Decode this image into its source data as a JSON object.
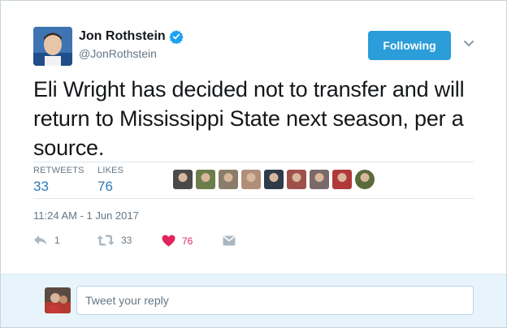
{
  "author": {
    "name": "Jon Rothstein",
    "handle": "@JonRothstein",
    "verified": true
  },
  "follow_button": {
    "label": "Following"
  },
  "tweet": {
    "text": "Eli Wright has decided not to transfer and will return to Mississippi State next season, per a source."
  },
  "stats": {
    "retweets_label": "RETWEETS",
    "retweets_value": "33",
    "likes_label": "LIKES",
    "likes_value": "76"
  },
  "liked_by_avatars": [
    {
      "color": "#4a4a4a"
    },
    {
      "color": "#6b7d4a"
    },
    {
      "color": "#8a7d6a"
    },
    {
      "color": "#b08f7a"
    },
    {
      "color": "#2f3a4a"
    },
    {
      "color": "#a0504a"
    },
    {
      "color": "#7a6a6a"
    },
    {
      "color": "#b03a3a"
    },
    {
      "color": "#5a6a3a"
    }
  ],
  "timestamp": "11:24 AM - 1 Jun 2017",
  "actions": {
    "reply_count": "1",
    "retweet_count": "33",
    "like_count": "76",
    "dm_icon": "envelope-icon"
  },
  "reply": {
    "placeholder": "Tweet your reply"
  },
  "colors": {
    "accent": "#2b9dd8",
    "link": "#2b7bb9",
    "like": "#e0245e",
    "muted": "#657786",
    "reply_bg": "#e8f4fb"
  }
}
